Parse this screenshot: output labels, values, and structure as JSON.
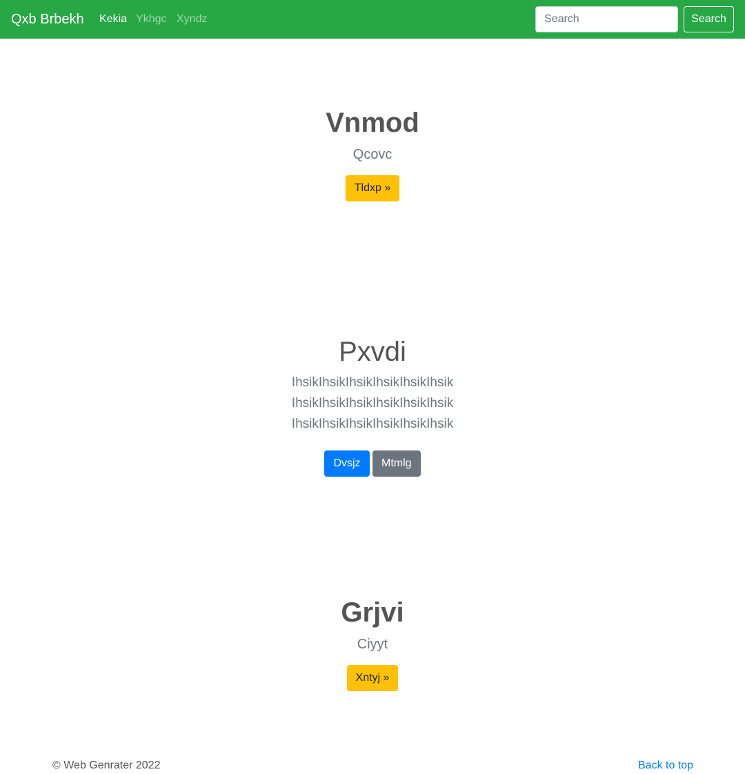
{
  "navbar": {
    "brand": "Qxb Brbekh",
    "links": [
      {
        "label": "Kekia",
        "active": true
      },
      {
        "label": "Ykhgc",
        "active": false
      },
      {
        "label": "Xyndz",
        "active": false
      }
    ],
    "search": {
      "placeholder": "Search",
      "button_label": "Search"
    }
  },
  "sections": [
    {
      "title": "Vnmod",
      "subtitle": "Qcovc",
      "button": "Tldxp »"
    },
    {
      "title": "Pxvdi",
      "text": "IhsikIhsikIhsikIhsikIhsikIhsik IhsikIhsikIhsikIhsikIhsikIhsik IhsikIhsikIhsikIhsikIhsikIhsik",
      "buttons": [
        "Dvsjz",
        "Mtmlg"
      ]
    },
    {
      "title": "Grjvi",
      "subtitle": "Ciyyt",
      "button": "Xntyj »"
    }
  ],
  "footer": {
    "copyright": "© Web Genrater 2022",
    "back_to_top": "Back to top"
  },
  "colors": {
    "navbar_bg": "#28a745",
    "warning": "#ffc107",
    "primary": "#007bff",
    "secondary": "#6c757d"
  }
}
